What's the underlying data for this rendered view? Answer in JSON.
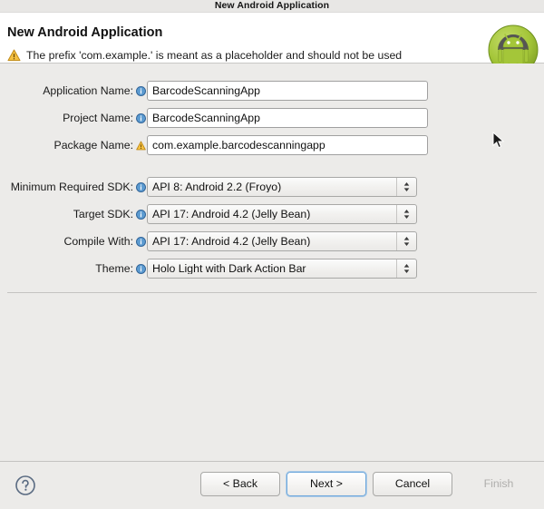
{
  "window": {
    "title": "New Android Application"
  },
  "header": {
    "title": "New Android Application",
    "message": "The prefix 'com.example.' is meant as a placeholder and should not be used",
    "warning_icon": "warning-triangle-icon",
    "logo_icon": "android-robot-icon"
  },
  "form": {
    "text_fields": [
      {
        "label": "Application Name:",
        "value": "BarcodeScanningApp",
        "icon": "info-icon"
      },
      {
        "label": "Project Name:",
        "value": "BarcodeScanningApp",
        "icon": "info-icon"
      },
      {
        "label": "Package Name:",
        "value": "com.example.barcodescanningapp",
        "icon": "warning-icon"
      }
    ],
    "dropdowns": [
      {
        "label": "Minimum Required SDK:",
        "value": "API 8: Android 2.2 (Froyo)",
        "icon": "info-icon"
      },
      {
        "label": "Target SDK:",
        "value": "API 17: Android 4.2 (Jelly Bean)",
        "icon": "info-icon"
      },
      {
        "label": "Compile With:",
        "value": "API 17: Android 4.2 (Jelly Bean)",
        "icon": "info-icon"
      },
      {
        "label": "Theme:",
        "value": "Holo Light with Dark Action Bar",
        "icon": "info-icon"
      }
    ]
  },
  "footer": {
    "help_icon": "help-question-icon",
    "buttons": [
      {
        "label": "< Back",
        "state": "enabled"
      },
      {
        "label": "Next >",
        "state": "focused"
      },
      {
        "label": "Cancel",
        "state": "enabled"
      },
      {
        "label": "Finish",
        "state": "disabled"
      }
    ]
  },
  "colors": {
    "background": "#ECEBE9",
    "header_background": "#FFFFFF",
    "accent_focus": "#6FA8DC",
    "warning": "#E8A317",
    "info": "#3A7CBE",
    "android_green": "#A4C639"
  }
}
